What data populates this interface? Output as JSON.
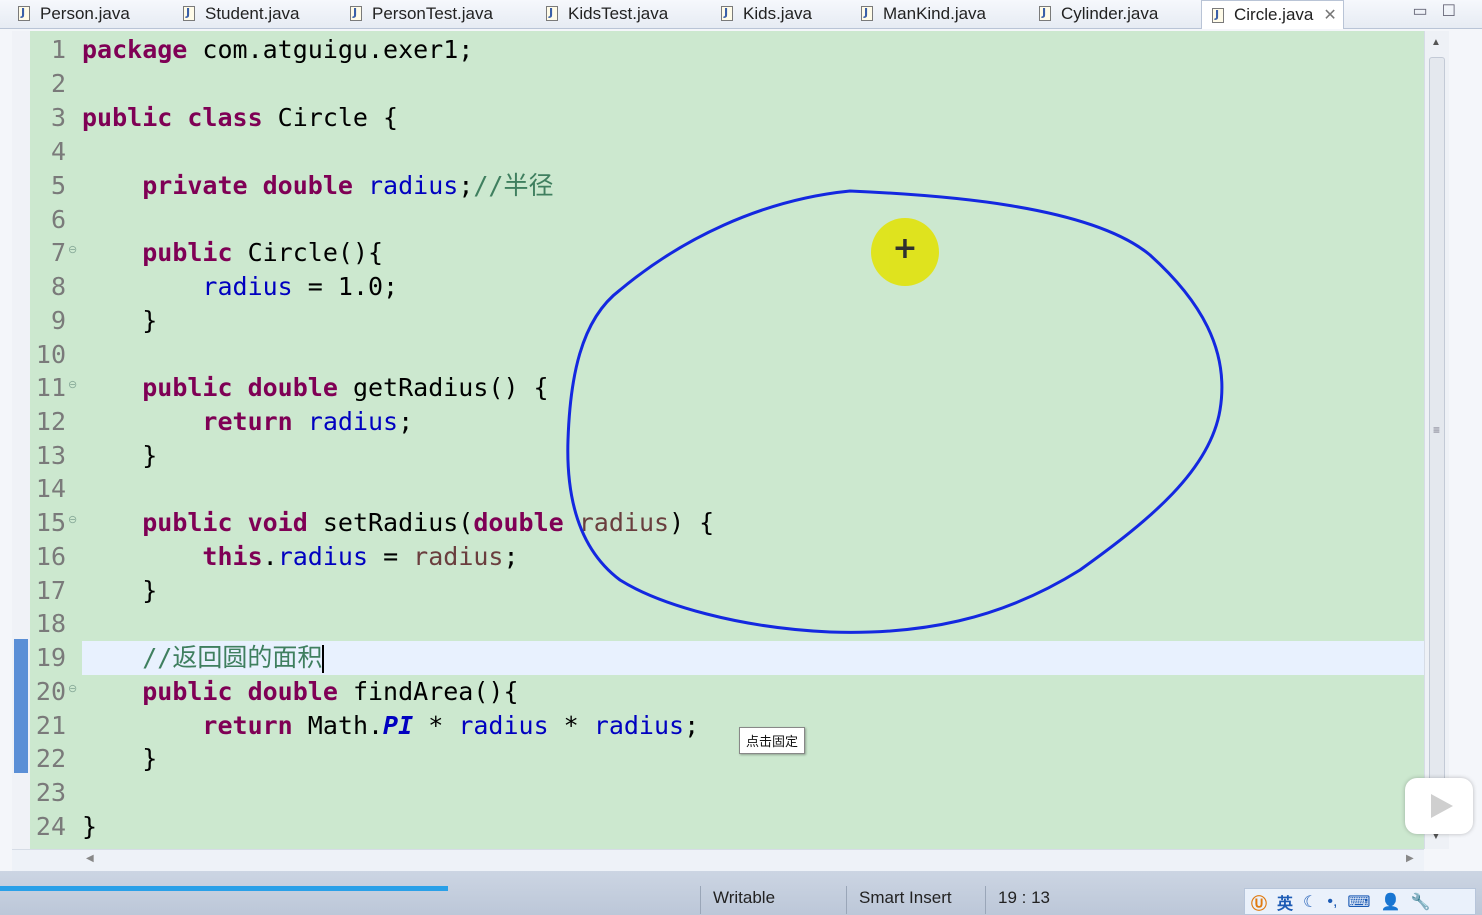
{
  "tabs": [
    {
      "label": "Person.java",
      "active": false
    },
    {
      "label": "Student.java",
      "active": false
    },
    {
      "label": "PersonTest.java",
      "active": false
    },
    {
      "label": "KidsTest.java",
      "active": false
    },
    {
      "label": "Kids.java",
      "active": false
    },
    {
      "label": "ManKind.java",
      "active": false
    },
    {
      "label": "Cylinder.java",
      "active": false
    },
    {
      "label": "Circle.java",
      "active": true
    }
  ],
  "editor": {
    "line_numbers": [
      "1",
      "2",
      "3",
      "4",
      "5",
      "6",
      "7",
      "8",
      "9",
      "10",
      "11",
      "12",
      "13",
      "14",
      "15",
      "16",
      "17",
      "18",
      "19",
      "20",
      "21",
      "22",
      "23",
      "24"
    ],
    "current_line": 19,
    "code": {
      "l1_kw": "package",
      "l1_rest": " com.atguigu.exer1;",
      "l3_kw": "public class",
      "l3_rest": " Circle {",
      "l5_kw": "private double",
      "l5_field": "radius",
      "l5_semi": ";",
      "l5_comment": "//半径",
      "l7_kw": "public",
      "l7_rest": " Circle(){",
      "l8_field": "radius",
      "l8_rest": " = 1.0;",
      "close_brace": "}",
      "l11_kw": "public double",
      "l11_rest": " getRadius() {",
      "l12_kw": "return",
      "l12_field": "radius",
      "l12_semi": ";",
      "l15_kw": "public void",
      "l15_mid": " setRadius(",
      "l15_kw2": "double",
      "l15_param": "radius",
      "l15_end": ") {",
      "l16_kw": "this",
      "l16_dot": ".",
      "l16_field": "radius",
      "l16_eq": " = ",
      "l16_param": "radius",
      "l16_semi": ";",
      "l19_comment": "//返回圆的面积",
      "l20_kw": "public double",
      "l20_rest": " findArea(){",
      "l21_kw": "return",
      "l21_math": " Math.",
      "l21_pi": "PI",
      "l21_op1": " * ",
      "l21_field1": "radius",
      "l21_op2": " * ",
      "l21_field2": "radius",
      "l21_semi": ";",
      "l24": "}"
    }
  },
  "tooltip": "点击固定",
  "status": {
    "writable": "Writable",
    "insert_mode": "Smart Insert",
    "position": "19 : 13"
  },
  "tray": {
    "ime_label": "英",
    "icons": [
      "ime-logo-icon",
      "moon-icon",
      "punctuation-icon",
      "keyboard-icon",
      "user-icon",
      "wrench-icon"
    ]
  },
  "colors": {
    "editor_bg": "#cce8cf",
    "keyword": "#7f0055",
    "field": "#0000c0",
    "comment": "#3f7f5f",
    "annotation_ink": "#1428e0",
    "pointer_highlight": "#e1e310"
  }
}
